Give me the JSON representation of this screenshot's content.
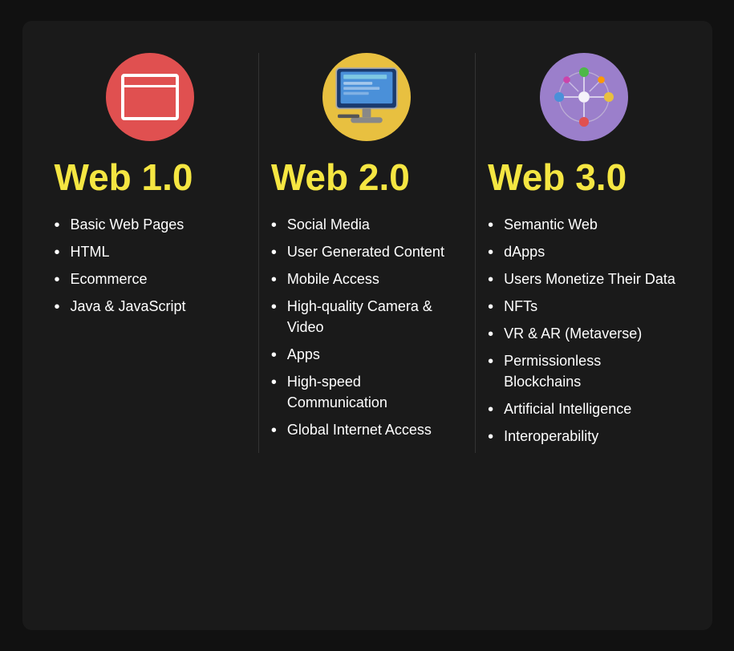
{
  "columns": [
    {
      "id": "web1",
      "icon_type": "browser",
      "title": "Web 1.0",
      "items": [
        "Basic Web Pages",
        "HTML",
        "Ecommerce",
        "Java & JavaScript"
      ]
    },
    {
      "id": "web2",
      "icon_type": "computer",
      "title": "Web 2.0",
      "items": [
        "Social Media",
        "User Generated Content",
        "Mobile Access",
        "High-quality Camera & Video",
        "Apps",
        "High-speed Communication",
        "Global Internet Access"
      ]
    },
    {
      "id": "web3",
      "icon_type": "network",
      "title": "Web 3.0",
      "items": [
        "Semantic Web",
        "dApps",
        "Users Monetize Their Data",
        "NFTs",
        "VR & AR (Metaverse)",
        "Permissionless Blockchains",
        "Artificial Intelligence",
        "Interoperability"
      ]
    }
  ]
}
